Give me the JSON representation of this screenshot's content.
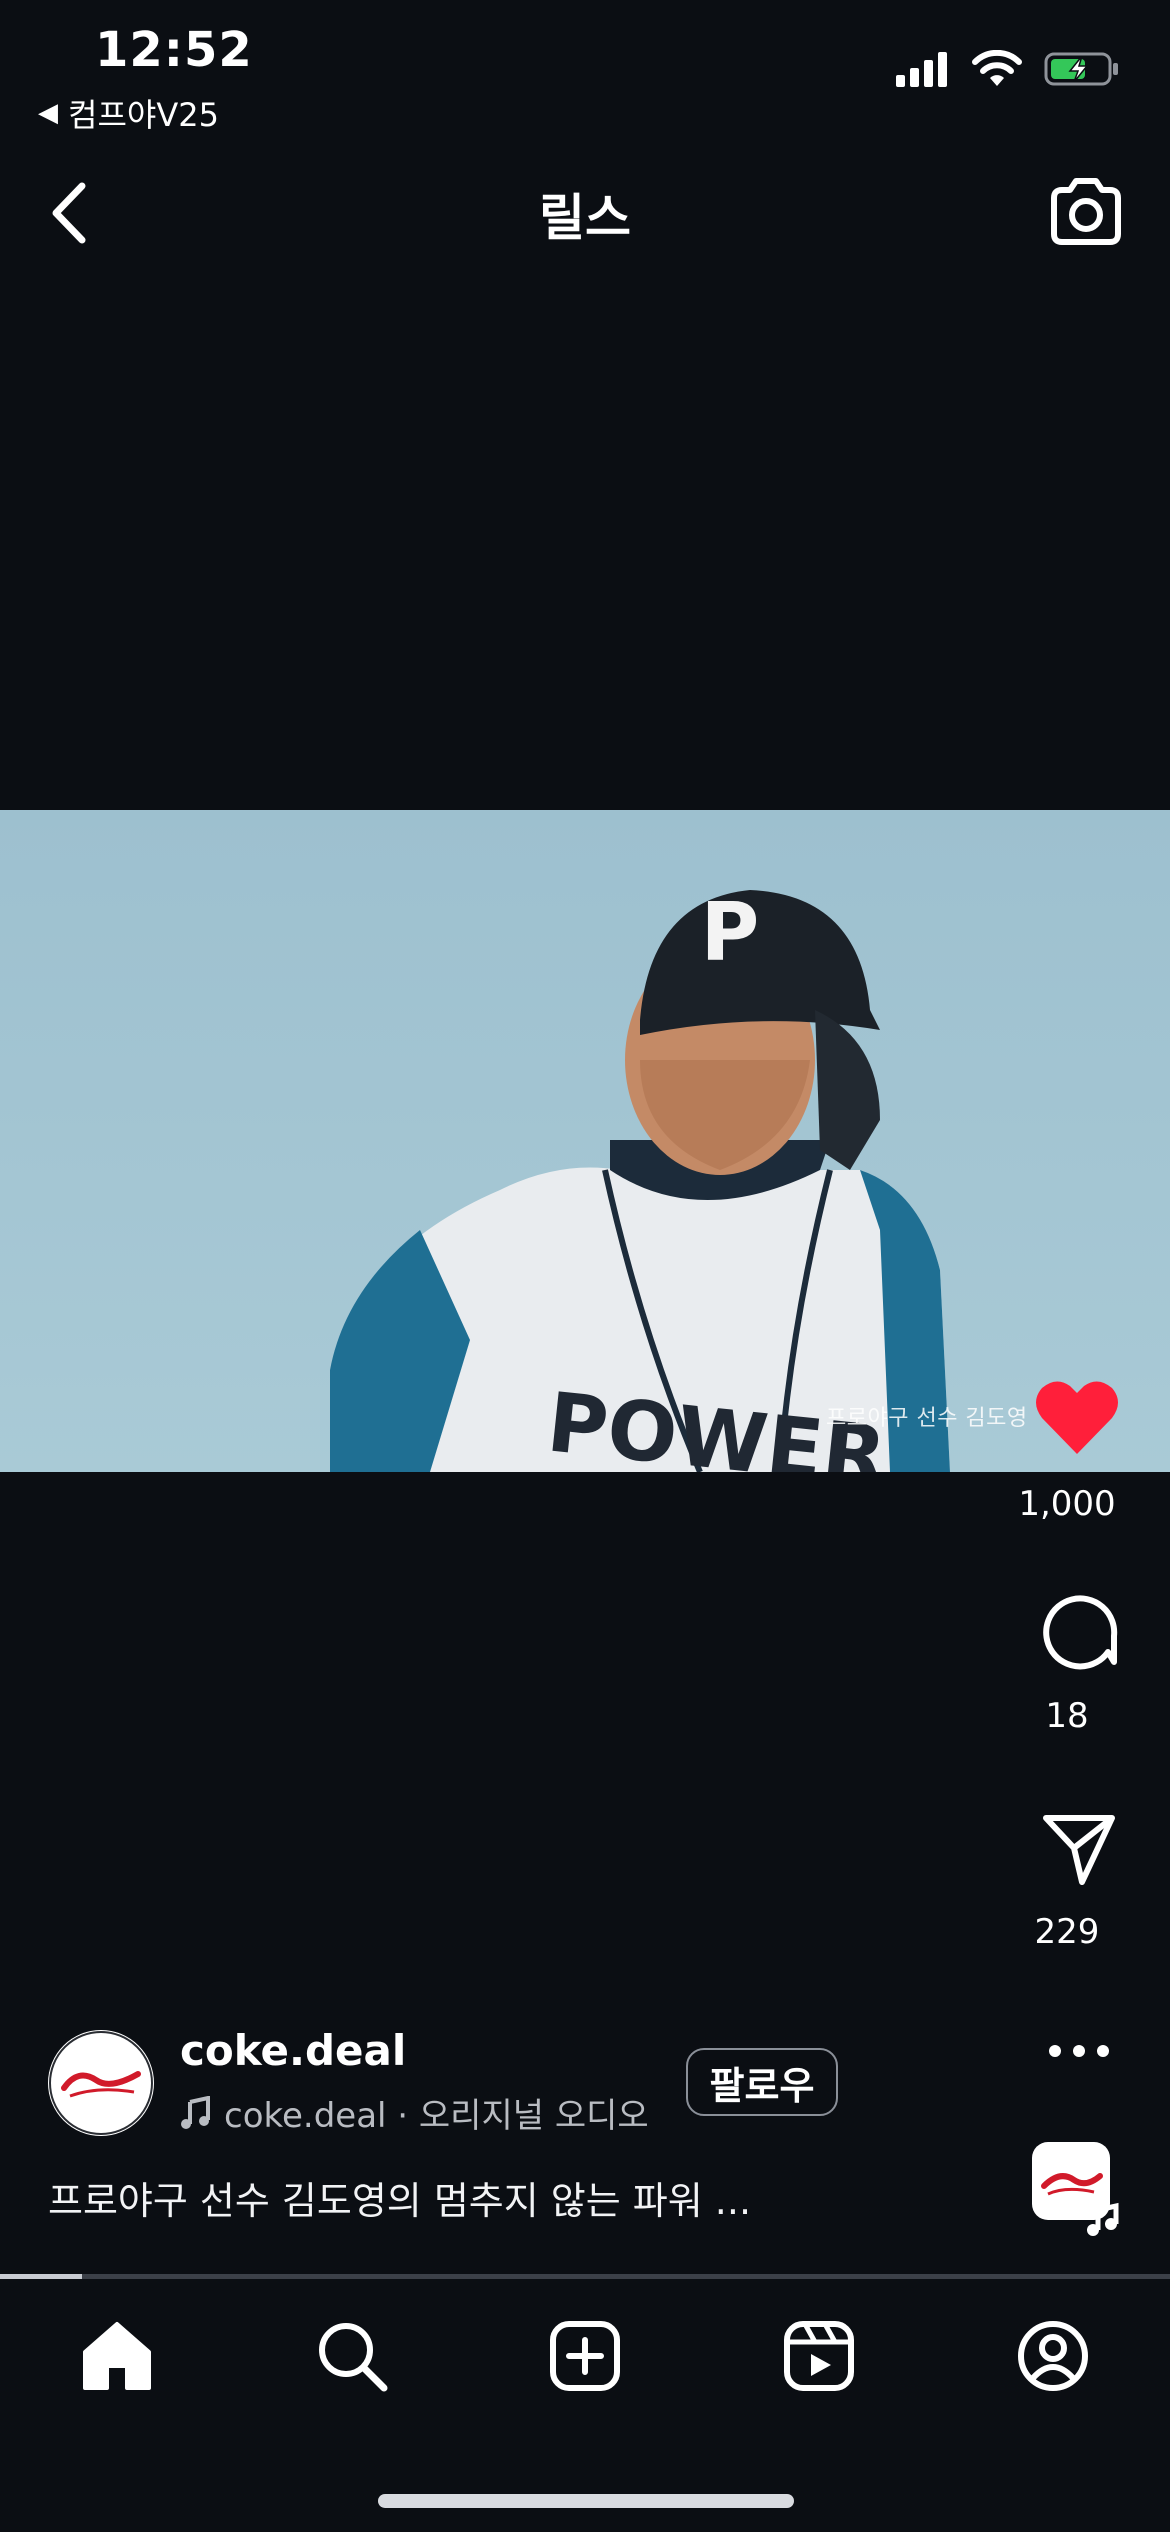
{
  "status_bar": {
    "time": "12:52",
    "back_app": "컴프야V25",
    "back_arrow": "◀",
    "icons": [
      "signal-icon",
      "wifi-icon",
      "battery-charging-icon"
    ]
  },
  "header": {
    "title": "릴스",
    "back_icon": "chevron-left-icon",
    "camera_icon": "camera-icon"
  },
  "video": {
    "overlay_caption": "프로야구 선수 김도영",
    "jersey_text": "POWER",
    "helmet_letter": "P"
  },
  "actions": {
    "likes": "1,000",
    "comments": "18",
    "shares": "229",
    "liked": true,
    "accent_color": "#ff1f3a"
  },
  "author": {
    "username": "coke.deal",
    "audio_text": "coke.deal · 오리지널 오디오",
    "follow_label": "팔로우",
    "avatar_brand": "Coca-Cola",
    "description": "프로야구 선수 김도영의 멈추지 않는 파워 ..."
  },
  "progress": {
    "fraction": 0.07
  },
  "bottom_nav": {
    "items": [
      "home-icon",
      "search-icon",
      "create-post-icon",
      "reels-icon",
      "profile-icon"
    ],
    "active": "home-icon"
  }
}
